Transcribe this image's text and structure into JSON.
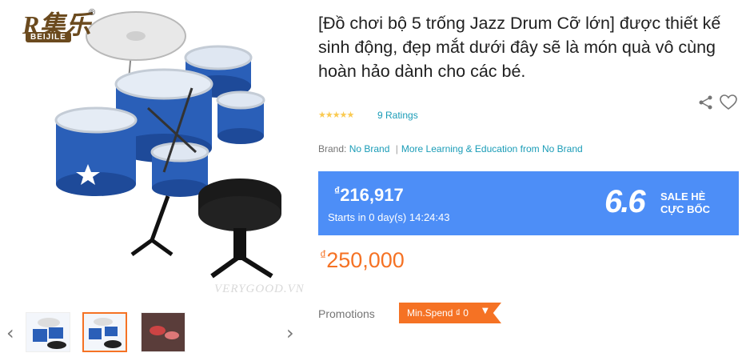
{
  "product": {
    "title": "[Đồ chơi bộ 5 trống Jazz Drum Cỡ lớn] được thiết kế sinh động, đẹp mắt dưới đây sẽ là món quà vô cùng hoàn hảo dành cho các bé.",
    "ratings_text": "9 Ratings",
    "stars": "★★★★★",
    "brand_label": "Brand:",
    "brand_name": "No Brand",
    "brand_separator": "|",
    "more_from": "More Learning & Education from No Brand"
  },
  "gallery": {
    "logo_text": "BEIJILE",
    "logo_mark": "®",
    "watermark": "VERYGOOD.VN",
    "prev_arrow": "‹",
    "next_arrow": "›",
    "thumbnails": [
      "drum-set-thumb-1",
      "drum-set-thumb-2",
      "drum-set-thumb-3"
    ]
  },
  "flash_sale": {
    "currency": "₫",
    "price": "216,917",
    "countdown": "Starts in 0 day(s) 14:24:43",
    "badge_number": "6.6",
    "badge_line1": "SALE HÈ",
    "badge_line2": "CỰC BỐC",
    "background_color": "#4d8ef7"
  },
  "original_price": {
    "currency": "₫",
    "value": "250,000",
    "color": "#f57224"
  },
  "promotions": {
    "label": "Promotions",
    "tag": "Min.Spend ₫ 0",
    "caret": "▼"
  },
  "icons": {
    "share": "share-icon",
    "wishlist": "heart-icon"
  }
}
